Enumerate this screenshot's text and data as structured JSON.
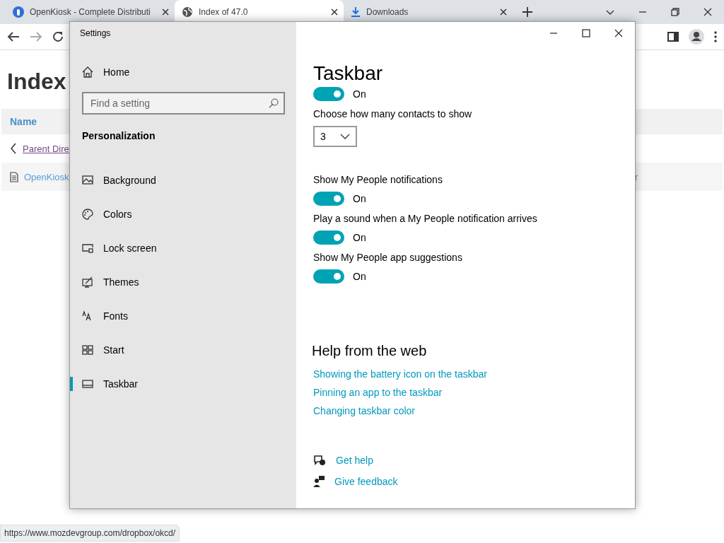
{
  "browser": {
    "tabs": [
      {
        "title": "OpenKiosk - Complete Distributi",
        "kind": "site",
        "selected": false
      },
      {
        "title": "Index of 47.0",
        "kind": "globe",
        "selected": true
      },
      {
        "title": "Downloads",
        "kind": "download",
        "selected": false
      }
    ],
    "page": {
      "heading": "Index",
      "columns": [
        "Name"
      ],
      "rows": [
        {
          "kind": "parent",
          "name": "Parent Dire"
        },
        {
          "kind": "file",
          "name": "OpenKiosk",
          "column_3": "r"
        }
      ]
    },
    "status_url": "https://www.mozdevgroup.com/dropbox/okcd/"
  },
  "settings": {
    "title": "Settings",
    "home": "Home",
    "search": {
      "placeholder": "Find a setting"
    },
    "section": "Personalization",
    "nav": [
      {
        "label": "Background",
        "selected": false
      },
      {
        "label": "Colors",
        "selected": false
      },
      {
        "label": "Lock screen",
        "selected": false
      },
      {
        "label": "Themes",
        "selected": false
      },
      {
        "label": "Fonts",
        "selected": false
      },
      {
        "label": "Start",
        "selected": false
      },
      {
        "label": "Taskbar",
        "selected": true
      }
    ],
    "page_title": "Taskbar",
    "options": [
      {
        "kind": "toggle",
        "on": true,
        "state_label": "On"
      },
      {
        "kind": "dropdown",
        "label": "Choose how many contacts to show",
        "value": "3"
      },
      {
        "kind": "toggle",
        "label": "Show My People notifications",
        "on": true,
        "state_label": "On"
      },
      {
        "kind": "toggle",
        "label": "Play a sound when a My People notification arrives",
        "on": true,
        "state_label": "On"
      },
      {
        "kind": "toggle",
        "label": "Show My People app suggestions",
        "on": true,
        "state_label": "On"
      }
    ],
    "help_title": "Help from the web",
    "links": [
      "Showing the battery icon on the taskbar",
      "Pinning an app to the taskbar",
      "Changing taskbar color"
    ],
    "footer_links": [
      "Get help",
      "Give feedback"
    ]
  }
}
